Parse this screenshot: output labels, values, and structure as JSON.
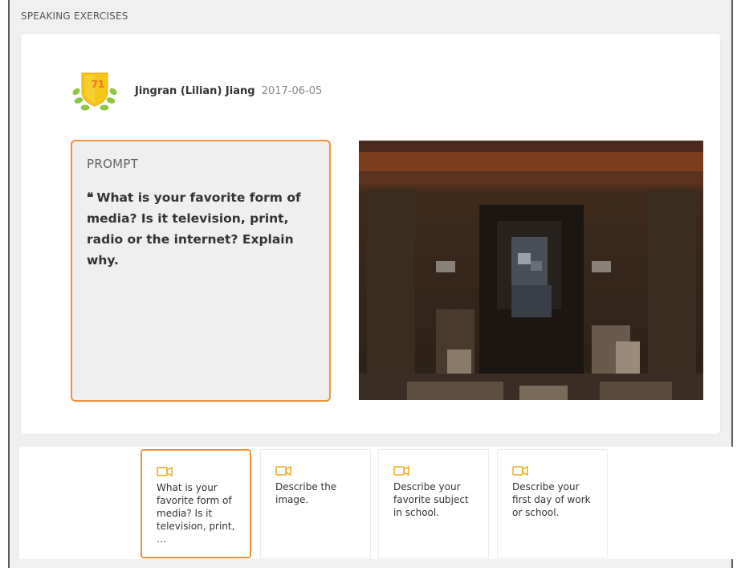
{
  "section": {
    "title": "SPEAKING EXERCISES"
  },
  "author": {
    "score": "71",
    "name": "Jingran (Lilian) Jiang",
    "date": "2017-06-05"
  },
  "prompt": {
    "label": "PROMPT",
    "text": "What is your favorite form of media? Is it television, print, radio or the internet? Explain why."
  },
  "exercises": [
    {
      "text": "What is your favorite form of media? Is it television, print, …",
      "active": true
    },
    {
      "text": "Describe the image.",
      "active": false
    },
    {
      "text": "Describe your favorite subject in school.",
      "active": false
    },
    {
      "text": "Describe your first day of work or school.",
      "active": false
    }
  ],
  "colors": {
    "accent": "#f0923c",
    "badge": "#f5c518",
    "leaf": "#8dc63f",
    "background": "#f0f0f0"
  }
}
